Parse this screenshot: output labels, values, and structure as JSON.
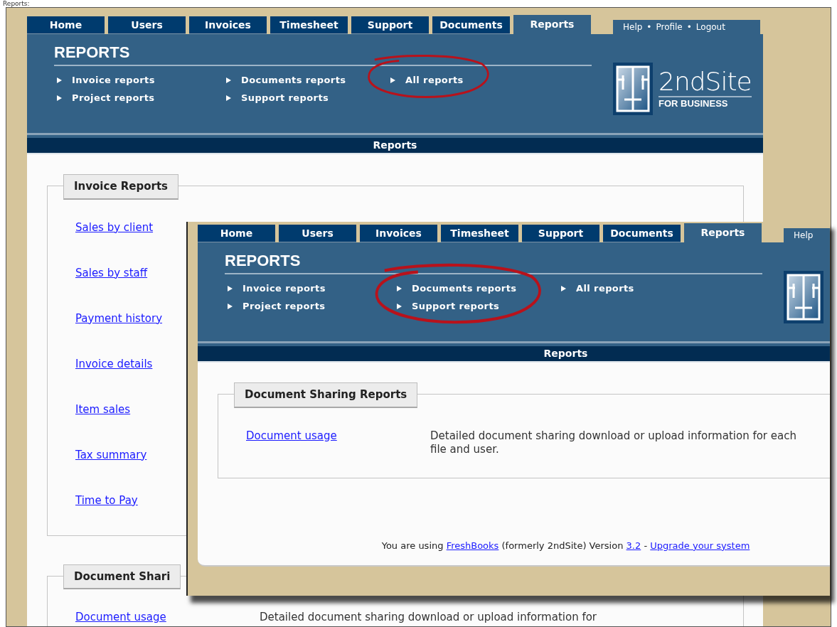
{
  "caption": "Reports:",
  "back": {
    "tabs": [
      {
        "label": "Home",
        "selected": false
      },
      {
        "label": "Users",
        "selected": false
      },
      {
        "label": "Invoices",
        "selected": false
      },
      {
        "label": "Timesheet",
        "selected": false
      },
      {
        "label": "Support",
        "selected": false
      },
      {
        "label": "Documents",
        "selected": false
      },
      {
        "label": "Reports",
        "selected": true
      }
    ],
    "user_links": [
      "Help",
      "Profile",
      "Logout"
    ],
    "separator": "•",
    "heading": "REPORTS",
    "nav": [
      {
        "items": [
          "Invoice reports",
          "Project reports"
        ],
        "annotated": false
      },
      {
        "items": [
          "Documents reports",
          "Support reports"
        ],
        "annotated": false
      },
      {
        "items": [
          "All reports"
        ],
        "annotated": true
      }
    ],
    "logo": {
      "name": "2ndSite",
      "tagline": "FOR BUSINESS"
    },
    "bar_title": "Reports",
    "sections": [
      {
        "title": "Invoice Reports",
        "rows": [
          {
            "link": "Sales by client"
          },
          {
            "link": "Sales by staff"
          },
          {
            "link": "Payment history"
          },
          {
            "link": "Invoice details"
          },
          {
            "link": "Item sales"
          },
          {
            "link": "Tax summary"
          },
          {
            "link": "Time to Pay"
          }
        ]
      },
      {
        "title": "Document Shari",
        "rows": [
          {
            "link": "Document usage",
            "description": "Detailed document sharing download or upload information for"
          }
        ]
      }
    ]
  },
  "front": {
    "tabs": [
      {
        "label": "Home",
        "selected": false
      },
      {
        "label": "Users",
        "selected": false
      },
      {
        "label": "Invoices",
        "selected": false
      },
      {
        "label": "Timesheet",
        "selected": false
      },
      {
        "label": "Support",
        "selected": false
      },
      {
        "label": "Documents",
        "selected": false
      },
      {
        "label": "Reports",
        "selected": true
      }
    ],
    "user_links": [
      "Help"
    ],
    "heading": "REPORTS",
    "nav": [
      {
        "items": [
          "Invoice reports",
          "Project reports"
        ],
        "annotated": false
      },
      {
        "items": [
          "Documents reports",
          "Support reports"
        ],
        "annotated": true
      },
      {
        "items": [
          "All reports"
        ],
        "annotated": false
      }
    ],
    "bar_title": "Reports",
    "sections": [
      {
        "title": "Document Sharing Reports",
        "rows": [
          {
            "link": "Document usage",
            "description": "Detailed document sharing download or upload information for each file and user."
          }
        ]
      }
    ],
    "footer": [
      {
        "kind": "text",
        "text": "You are using"
      },
      {
        "kind": "link",
        "text": "FreshBooks"
      },
      {
        "kind": "text",
        "text": "(formerly 2ndSite) Version"
      },
      {
        "kind": "link",
        "text": "3.2"
      },
      {
        "kind": "text",
        "text": "-"
      },
      {
        "kind": "link",
        "text": "Upgrade your system"
      }
    ]
  }
}
